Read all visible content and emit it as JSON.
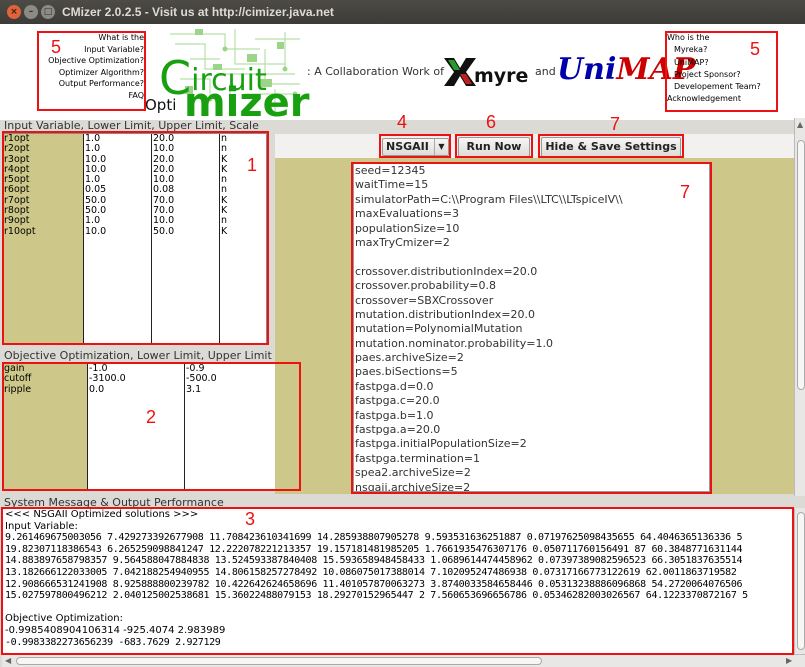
{
  "window": {
    "title": "CMizer 2.0.2.5 - Visit us at http://cimizer.java.net"
  },
  "header": {
    "left_links": [
      "What is the",
      "Input Variable?",
      "Objective Optimization?",
      "Optimizer Algorithm?",
      "Output Performance?",
      "FAQ"
    ],
    "right_links": [
      "Who is the",
      "Myreka?",
      "UniMAP?",
      "Project Sponsor?",
      "Developement Team?",
      "Acknowledgement"
    ],
    "logo": {
      "circuit_c": "C",
      "circuit_rest": "ircuit",
      "opti": "Opti",
      "mizer": "mizer"
    },
    "collab_text": ": A Collaboration Work of",
    "myreka_label": "myreka",
    "and_text": "and",
    "unimap_uni": "Uni",
    "unimap_map": "MAP"
  },
  "annotations": {
    "input_table": "1",
    "objective_table": "2",
    "output": "3",
    "algorithm": "4",
    "help_left": "5",
    "help_right": "5",
    "run": "6",
    "hide_save": "7",
    "settings": "7"
  },
  "input_section": {
    "label": "Input Variable, Lower Limit, Upper Limit, Scale",
    "names": [
      "r1opt",
      "r2opt",
      "r3opt",
      "r4opt",
      "r5opt",
      "r6opt",
      "r7opt",
      "r8opt",
      "r9opt",
      "r10opt"
    ],
    "lower": [
      "1.0",
      "1.0",
      "10.0",
      "10.0",
      "1.0",
      "0.05",
      "50.0",
      "50.0",
      "1.0",
      "10.0"
    ],
    "upper": [
      "20.0",
      "10.0",
      "20.0",
      "20.0",
      "10.0",
      "0.08",
      "70.0",
      "70.0",
      "10.0",
      "50.0"
    ],
    "scale": [
      "n",
      "n",
      "K",
      "K",
      "n",
      "n",
      "K",
      "K",
      "n",
      "K"
    ]
  },
  "objective_section": {
    "label": "Objective Optimization, Lower Limit, Upper Limit",
    "names": [
      "gain",
      "cutoff",
      "ripple"
    ],
    "lower": [
      "-1.0",
      "-3100.0",
      "0.0"
    ],
    "upper": [
      "-0.9",
      "-500.0",
      "3.1"
    ]
  },
  "toolbar": {
    "algorithm_selected": "NSGAII",
    "run_label": "Run Now",
    "hide_save_label": "Hide & Save Settings"
  },
  "settings_lines": [
    "seed=12345",
    "waitTime=15",
    "simulatorPath=C:\\\\Program Files\\\\LTC\\\\LTspiceIV\\\\",
    "maxEvaluations=3",
    "populationSize=10",
    "maxTryCmizer=2",
    "",
    "crossover.distributionIndex=20.0",
    "crossover.probability=0.8",
    "crossover=SBXCrossover",
    "mutation.distributionIndex=20.0",
    "mutation=PolynomialMutation",
    "mutation.nominator.probability=1.0",
    "paes.archiveSize=2",
    "paes.biSections=5",
    "fastpga.d=0.0",
    "fastpga.c=20.0",
    "fastpga.b=1.0",
    "fastpga.a=20.0",
    "fastpga.initialPopulationSize=2",
    "fastpga.termination=1",
    "spea2.archiveSize=2",
    "nsgaii.archiveSize=2"
  ],
  "output_section": {
    "label": "System Message & Output Performance",
    "lines": [
      "<<< NSGAII Optimized solutions >>>",
      "Input Variable:",
      "9.261469675003056 7.429273392677908 11.708423610341699 14.285938807905278 9.593531636251887 0.07197625098435655 64.4046365136336 5",
      "19.82307118386543 6.265259098841247 12.222078221213357 19.157181481985205 1.7661935476307176 0.050711760156491 87 60.3848771631144",
      "14.883897658798357 9.564588047884838 13.524593387840408 15.593658948458433 1.0689614474458962 0.07397389082596523 66.3051837635514",
      "13.182666122033005 7.042188254940955 14.806158257278492 10.086075017388014 7.102095247486938 0.07317166773122619 62.0011863719582",
      "12.908666531241908 8.925888800239782 10.422642624658696 11.401057870063273 3.8740033584658446 0.05313238886096868 54.2720064076506",
      "15.027597800496212 2.040125002538681 15.36022488079153 18.29270152965447 2 7.560653696656786 0.05346282003026567 64.1223370872167 5",
      "",
      "Objective Optimization:",
      "-0.9985408904106314 -925.4074 2.983989",
      "-0.9983382273656239 -683.7629 2.927129"
    ]
  }
}
